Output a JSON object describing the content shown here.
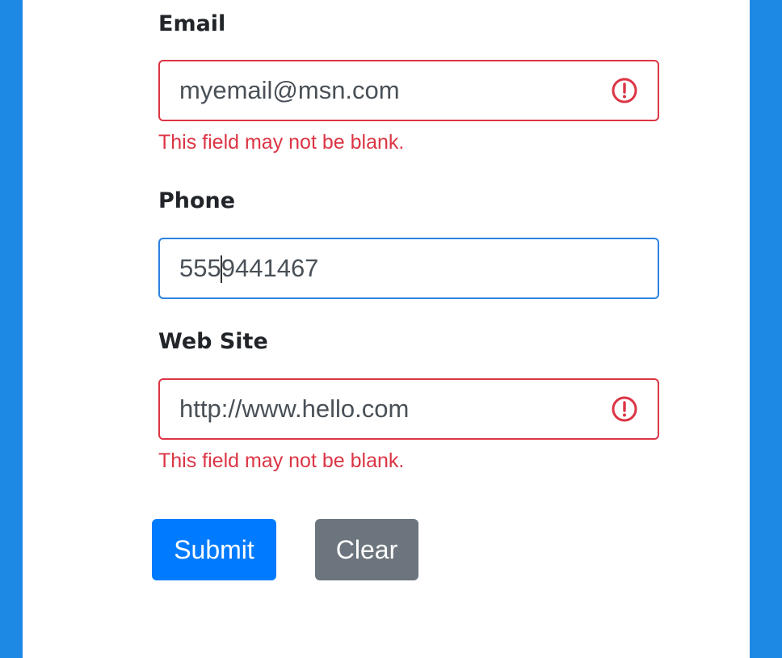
{
  "form": {
    "email": {
      "label": "Email",
      "value": "myemail@msn.com",
      "error": "This field may not be blank."
    },
    "phone": {
      "label": "Phone",
      "value_before_caret": "555",
      "value_after_caret": "9441467"
    },
    "website": {
      "label": "Web Site",
      "value": "http://www.hello.com",
      "error": "This field may not be blank."
    }
  },
  "buttons": {
    "submit_label": "Submit",
    "clear_label": "Clear"
  },
  "colors": {
    "background": "#1e88e5",
    "error": "#dc3545",
    "focus_border": "#2c82e0",
    "primary": "#007bff",
    "secondary": "#6c757d"
  },
  "icons": {
    "error": "exclamation-circle-icon"
  }
}
